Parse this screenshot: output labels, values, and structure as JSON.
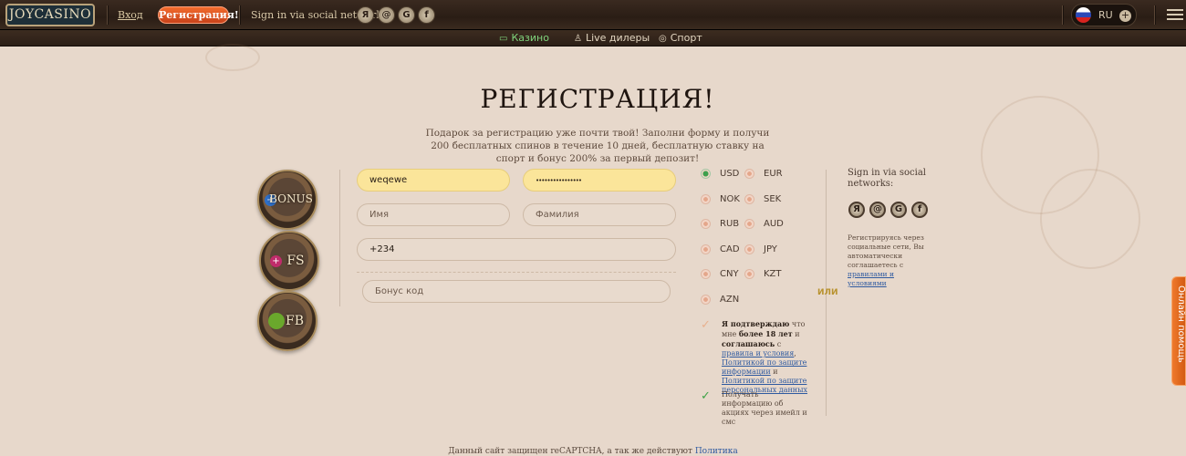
{
  "header": {
    "logo": "JOYCASINO",
    "login": "Вход",
    "register": "Регистрация!",
    "social_label": "Sign in via social networks:",
    "social_icons": [
      {
        "name": "yandex",
        "glyph": "Я"
      },
      {
        "name": "mailru",
        "glyph": "@"
      },
      {
        "name": "google",
        "glyph": "G"
      },
      {
        "name": "facebook",
        "glyph": "f"
      }
    ],
    "language": "RU",
    "lang_plus": "+"
  },
  "subnav": {
    "items": [
      {
        "label": "Казино",
        "active": true
      },
      {
        "label": "Live дилеры",
        "active": false
      },
      {
        "label": "Спорт",
        "active": false
      }
    ]
  },
  "main": {
    "title": "РЕГИСТРАЦИЯ!",
    "subtitle": "Подарок за регистрацию уже почти твой! Заполни форму и получи 200 бесплатных спинов в течение 10 дней, бесплатную ставку на спорт и бонус 200% за первый депозит!",
    "badges": [
      {
        "label": "BONUS",
        "dot": "+",
        "dot_color": "#2e6fc8"
      },
      {
        "label": "FS",
        "dot": "+",
        "dot_color": "#c02c6b"
      },
      {
        "label": "FB",
        "dot": "",
        "dot_color": "#6aa82c"
      }
    ]
  },
  "form": {
    "login_value": "weqewe",
    "password_value": "••••••••••••••••",
    "first_name_placeholder": "Имя",
    "last_name_placeholder": "Фамилия",
    "phone_value": "+234",
    "promo_placeholder": "Бонус код"
  },
  "currencies": {
    "selected": "USD",
    "list": [
      "USD",
      "EUR",
      "NOK",
      "SEK",
      "RUB",
      "AUD",
      "CAD",
      "JPY",
      "CNY",
      "KZT",
      "AZN"
    ]
  },
  "or_label": "или",
  "agree": {
    "bold1": "Я подтверждаю",
    "text1": " что мне ",
    "bold2": "более 18 лет",
    "text2": " и ",
    "bold3": "соглашаюсь",
    "text3": " с ",
    "link1": "правила и условия",
    "text4": ", ",
    "link2": "Политикой по защите информации",
    "text5": " и ",
    "link3": "Политикой по защите персональных данных",
    "checked": false
  },
  "newsletter": {
    "text": "Получать информацию об акциях через имейл и смс",
    "checked": true
  },
  "side": {
    "title": "Sign in via social networks:",
    "note": "Регистрируясь через социальные сети, Вы автоматически соглашаетесь с ",
    "note_link": "правилами и условиями"
  },
  "footer": {
    "text": "Данный сайт защищен reCAPTCHA, а так же действуют ",
    "link": "Политика"
  },
  "help_tab": "Онлайн помощь"
}
